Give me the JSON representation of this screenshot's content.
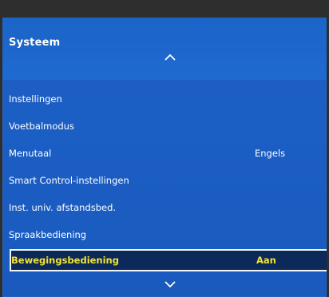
{
  "panel": {
    "title": "Systeem"
  },
  "menu": {
    "items": [
      {
        "label": "Instellingen",
        "value": ""
      },
      {
        "label": "Voetbalmodus",
        "value": ""
      },
      {
        "label": "Menutaal",
        "value": "Engels"
      },
      {
        "label": "Smart Control-instellingen",
        "value": ""
      },
      {
        "label": "Inst. univ. afstandsbed.",
        "value": ""
      },
      {
        "label": "Spraakbediening",
        "value": ""
      },
      {
        "label": "Bewegingsbediening",
        "value": "Aan",
        "selected": true
      }
    ]
  },
  "colors": {
    "panel_blue": "#1b5ec4",
    "selected_bg": "#0b2a5a",
    "selected_text": "#f4e430",
    "text": "#ffffff"
  },
  "icons": {
    "scroll_up": "chevron-up-icon",
    "scroll_down": "chevron-down-icon"
  }
}
